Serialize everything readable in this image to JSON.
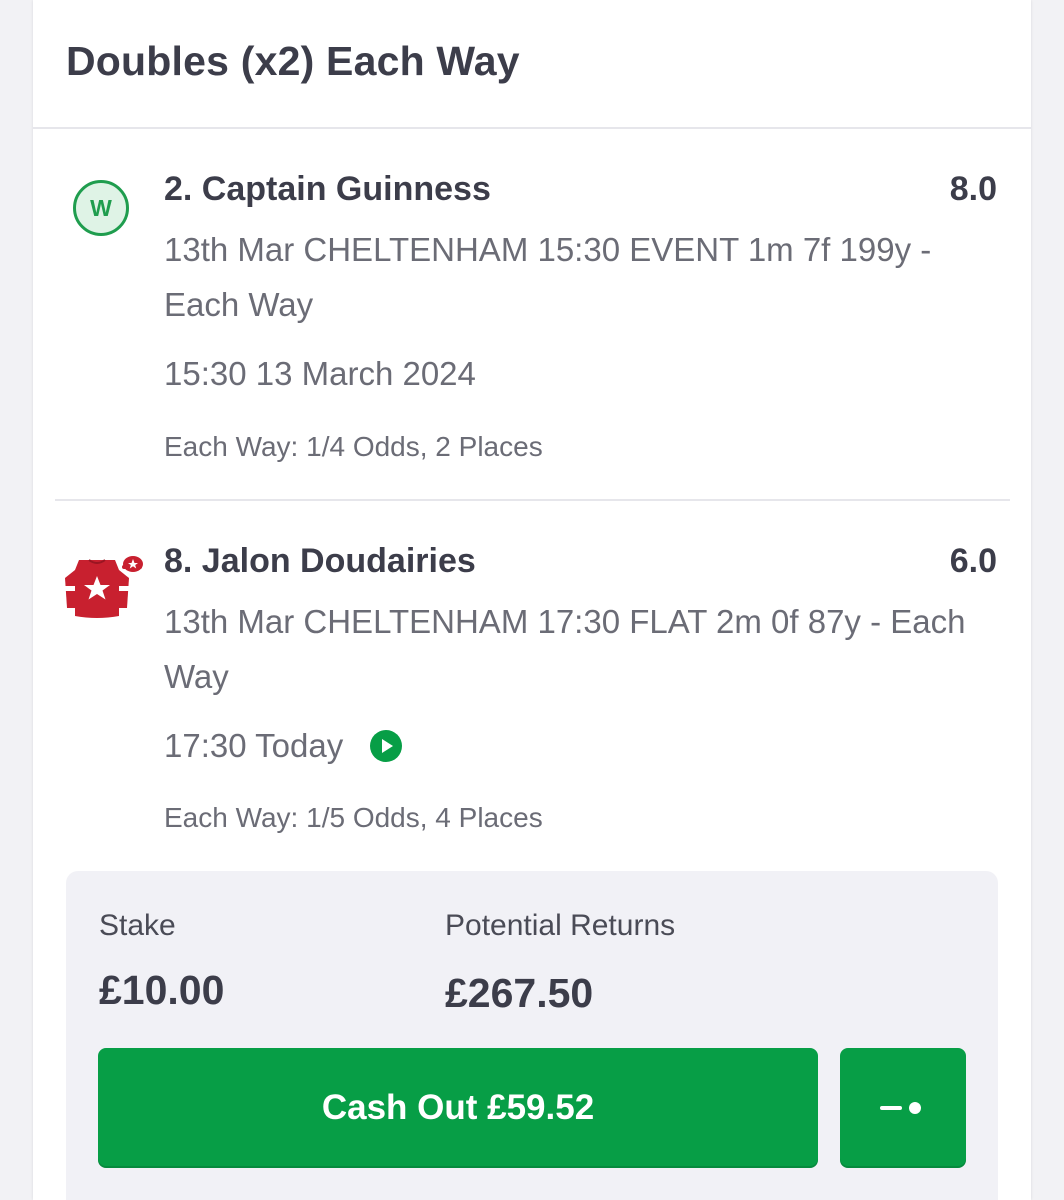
{
  "header": {
    "title": "Doubles (x2) Each Way"
  },
  "selections": [
    {
      "name": "2. Captain Guinness",
      "odds": "8.0",
      "description": "13th Mar CHELTENHAM 15:30 EVENT 1m 7f 199y - Each Way",
      "time": "15:30 13 March 2024",
      "each_way": "Each Way: 1/4 Odds, 2 Places",
      "result_badge": "W",
      "icon": "win-badge-icon"
    },
    {
      "name": "8. Jalon Doudairies",
      "odds": "6.0",
      "description": "13th Mar CHELTENHAM 17:30 FLAT 2m 0f 87y - Each Way",
      "time": "17:30 Today",
      "each_way": "Each Way: 1/5 Odds, 4 Places",
      "icon": "jockey-silks-icon",
      "live_icon": "play-icon"
    }
  ],
  "summary": {
    "stake_label": "Stake",
    "stake_value": "£10.00",
    "returns_label": "Potential Returns",
    "returns_value": "£267.50",
    "cashout_label": "Cash Out £59.52",
    "partial_icon": "partial-cashout-slider-icon"
  },
  "colors": {
    "brand_green": "#079e46",
    "badge_green": "#1f9d4e",
    "silks_red": "#c8202f"
  }
}
